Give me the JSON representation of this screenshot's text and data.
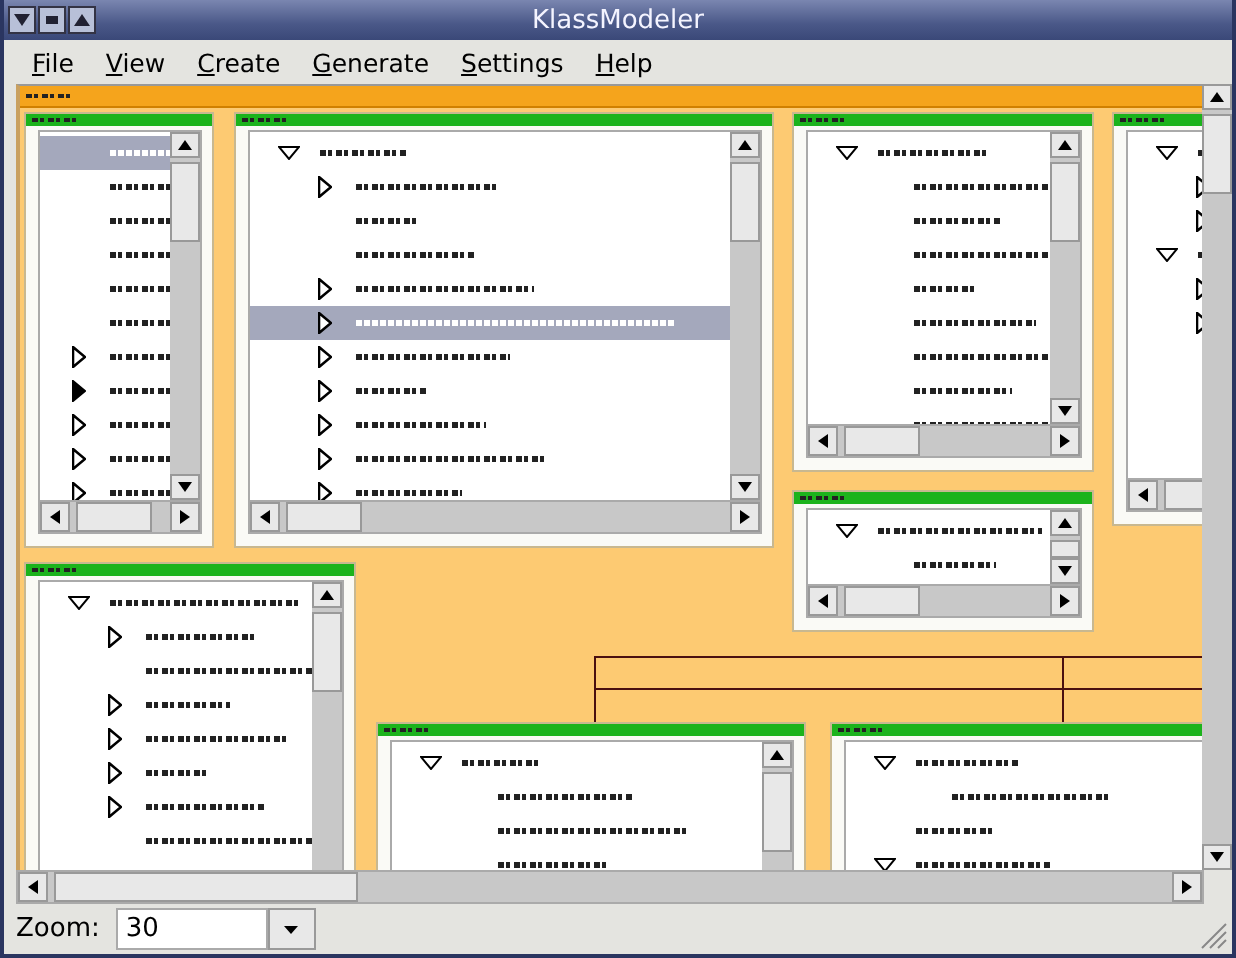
{
  "window": {
    "title": "KlassModeler"
  },
  "menu": [
    {
      "label": "File"
    },
    {
      "label": "View"
    },
    {
      "label": "Create"
    },
    {
      "label": "Generate"
    },
    {
      "label": "Settings"
    },
    {
      "label": "Help"
    }
  ],
  "diagram": {
    "boxes": [
      {
        "rows": [
          {
            "kind": "leaf",
            "selected": true
          },
          {
            "kind": "leaf",
            "selected": false
          },
          {
            "kind": "leaf",
            "selected": false
          },
          {
            "kind": "leaf",
            "selected": false
          },
          {
            "kind": "leaf",
            "selected": false
          },
          {
            "kind": "leaf",
            "selected": false
          },
          {
            "kind": "collapsed",
            "selected": false
          },
          {
            "kind": "marked",
            "selected": false
          },
          {
            "kind": "collapsed",
            "selected": false
          },
          {
            "kind": "collapsed",
            "selected": false
          },
          {
            "kind": "collapsed",
            "selected": false
          }
        ]
      },
      {
        "rows": [
          {
            "kind": "expanded",
            "selected": false,
            "children": [
              {
                "kind": "collapsed",
                "selected": false
              },
              {
                "kind": "leaf",
                "selected": false
              },
              {
                "kind": "leaf",
                "selected": false
              },
              {
                "kind": "collapsed",
                "selected": false
              },
              {
                "kind": "collapsed",
                "selected": true
              },
              {
                "kind": "collapsed",
                "selected": false
              },
              {
                "kind": "collapsed",
                "selected": false
              },
              {
                "kind": "collapsed",
                "selected": false
              },
              {
                "kind": "collapsed",
                "selected": false
              },
              {
                "kind": "collapsed",
                "selected": false
              }
            ]
          }
        ]
      },
      {
        "rows": [
          {
            "kind": "expanded",
            "selected": false,
            "children": [
              {
                "kind": "leaf",
                "selected": false
              },
              {
                "kind": "leaf",
                "selected": false
              },
              {
                "kind": "leaf",
                "selected": false
              },
              {
                "kind": "leaf",
                "selected": false
              },
              {
                "kind": "leaf",
                "selected": false
              },
              {
                "kind": "leaf",
                "selected": false
              },
              {
                "kind": "leaf",
                "selected": false
              },
              {
                "kind": "leaf",
                "selected": false
              }
            ]
          }
        ]
      },
      {
        "rows": [
          {
            "kind": "expanded",
            "selected": false,
            "children": [
              {
                "kind": "collapsed",
                "selected": false
              },
              {
                "kind": "collapsed",
                "selected": false
              }
            ]
          },
          {
            "kind": "expanded",
            "selected": false,
            "children": [
              {
                "kind": "collapsed",
                "selected": false
              },
              {
                "kind": "collapsed",
                "selected": false
              }
            ]
          }
        ]
      },
      {
        "rows": [
          {
            "kind": "expanded",
            "selected": false,
            "children": [
              {
                "kind": "leaf",
                "selected": false
              }
            ]
          }
        ]
      },
      {
        "rows": [
          {
            "kind": "expanded",
            "selected": false,
            "children": [
              {
                "kind": "collapsed",
                "selected": false
              },
              {
                "kind": "leaf",
                "selected": false
              },
              {
                "kind": "collapsed",
                "selected": false
              },
              {
                "kind": "collapsed",
                "selected": false
              },
              {
                "kind": "collapsed",
                "selected": false
              },
              {
                "kind": "collapsed",
                "selected": false
              },
              {
                "kind": "leaf",
                "selected": false
              }
            ]
          }
        ]
      },
      {
        "rows": [
          {
            "kind": "expanded",
            "selected": false,
            "children": [
              {
                "kind": "leaf",
                "selected": false
              },
              {
                "kind": "leaf",
                "selected": false
              },
              {
                "kind": "leaf",
                "selected": false
              }
            ]
          }
        ]
      },
      {
        "rows": [
          {
            "kind": "expanded",
            "selected": false,
            "children": [
              {
                "kind": "leaf",
                "selected": false
              }
            ]
          },
          {
            "kind": "leaf",
            "selected": false
          },
          {
            "kind": "expanded",
            "selected": false
          }
        ]
      }
    ]
  },
  "zoom": {
    "label": "Zoom:",
    "value": "30"
  }
}
